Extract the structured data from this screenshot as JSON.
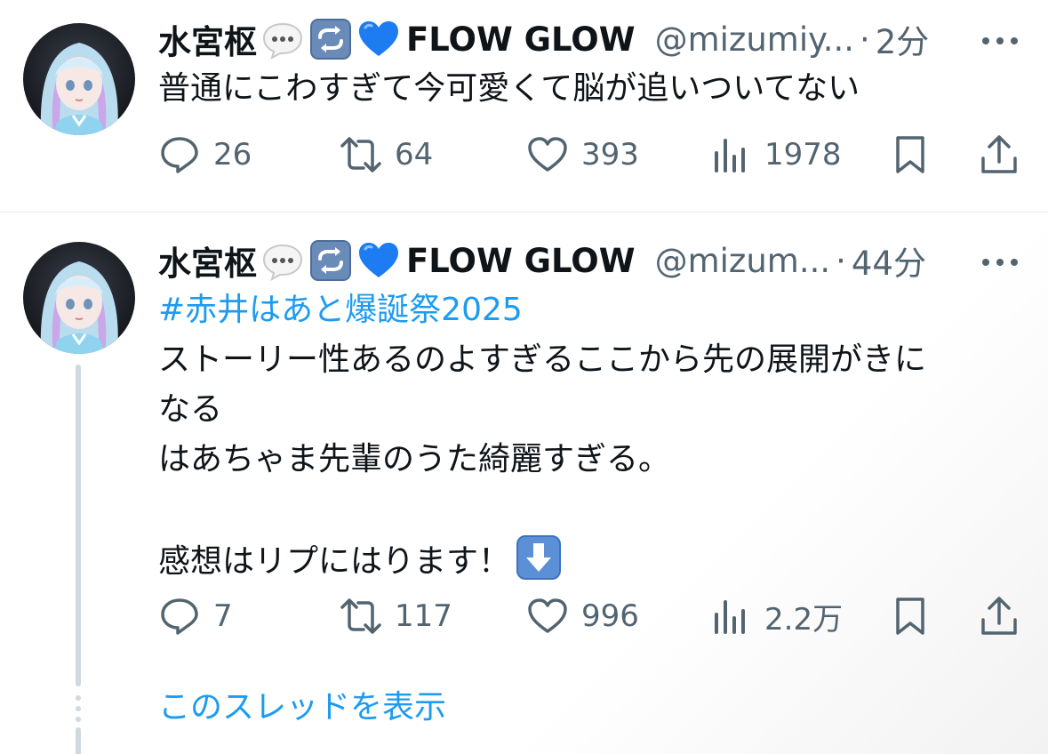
{
  "tweets": [
    {
      "display_name": "水宮枢",
      "brand": "FLOW GLOW",
      "handle": "@mizumiy...",
      "separator": "·",
      "time": "2分",
      "text": "普通にこわすぎて今可愛くて脳が追いついてない",
      "actions": {
        "replies": "26",
        "retweets": "64",
        "likes": "393",
        "views": "1978"
      }
    },
    {
      "display_name": "水宮枢",
      "brand": "FLOW GLOW",
      "handle": "@mizum...",
      "separator": "·",
      "time": "44分",
      "hashtag": "#赤井はあと爆誕祭2025",
      "text_line1": "ストーリー性あるのよすぎるここから先の展開がきに",
      "text_line2": "なる",
      "text_line3": "はあちゃま先輩のうた綺麗すぎる。",
      "text_line5": "感想はリプにはります！",
      "actions": {
        "replies": "7",
        "retweets": "117",
        "likes": "996",
        "views": "2.2万"
      }
    }
  ],
  "show_thread_label": "このスレッドを表示",
  "icons": {
    "reply": "speech-bubble-icon",
    "retweet": "retweet-arrows-icon",
    "like": "heart-icon",
    "views": "bar-chart-icon",
    "bookmark": "bookmark-icon",
    "share": "share-upload-icon",
    "more": "more-dots-icon"
  },
  "colors": {
    "text": "#0f1419",
    "secondary": "#536471",
    "link": "#1d9bf0",
    "thread_line": "#cfd9de",
    "heart_emoji": "#1e7cf2"
  }
}
